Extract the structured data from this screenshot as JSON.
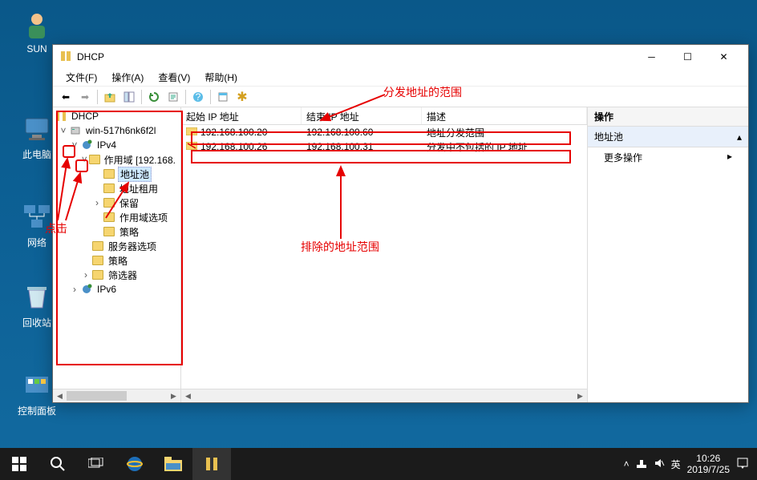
{
  "desktop": {
    "icons": [
      {
        "name": "SUN"
      },
      {
        "name": "此电脑"
      },
      {
        "name": "网络"
      },
      {
        "name": "回收站"
      },
      {
        "name": "控制面板"
      }
    ]
  },
  "window": {
    "title": "DHCP",
    "menus": [
      {
        "label": "文件(F)",
        "key": "file"
      },
      {
        "label": "操作(A)",
        "key": "action"
      },
      {
        "label": "查看(V)",
        "key": "view"
      },
      {
        "label": "帮助(H)",
        "key": "help"
      }
    ]
  },
  "tree": {
    "root": "DHCP",
    "server": "win-517h6nk6f2l",
    "ipv4": "IPv4",
    "scope": "作用域 [192.168.",
    "addressPool": "地址池",
    "leases": "地址租用",
    "reservations": "保留",
    "scopeOptions": "作用域选项",
    "policies_scope": "策略",
    "serverOptions": "服务器选项",
    "policies_server": "策略",
    "filters": "筛选器",
    "ipv6": "IPv6"
  },
  "list": {
    "headers": {
      "start": "起始 IP 地址",
      "end": "结束 IP 地址",
      "desc": "描述"
    },
    "rows": [
      {
        "start": "192.168.100.20",
        "end": "192.168.100.60",
        "desc": "地址分发范围"
      },
      {
        "start": "192.168.100.26",
        "end": "192.168.100.31",
        "desc": "分发中不包括的 IP 地址"
      }
    ]
  },
  "actions": {
    "header": "操作",
    "subheader": "地址池",
    "more": "更多操作"
  },
  "annotations": {
    "distribute_range": "分发地址的范围",
    "exclude_range": "排除的地址范围",
    "click_hint": "点击"
  },
  "taskbar": {
    "ime": "英",
    "time": "10:26",
    "date": "2019/7/25"
  }
}
